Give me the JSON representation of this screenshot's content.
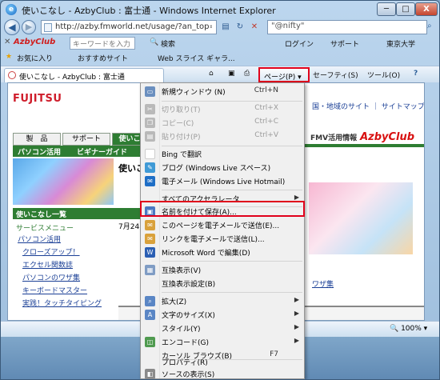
{
  "window": {
    "title": "使いこなし - AzbyClub : 富士通 - Windows Internet Explorer",
    "minimize": "─",
    "maximize": "□",
    "close": "X"
  },
  "address_bar": {
    "url": "http://azby.fmworld.net/usage/?an_top=",
    "search_text": "\"@nifty\""
  },
  "toolbar_azby": {
    "brand": "AzbyClub",
    "keyword_placeholder": "キーワードを入力",
    "search_label": "検索",
    "login_label": "ログイン",
    "support_label": "サポート",
    "univ_label": "東京大学"
  },
  "favorites_bar": {
    "favorites_label": "お気に入り",
    "suggested_label": "おすすめサイト",
    "webslice_label": "Web スライス ギャラ..."
  },
  "command_bar": {
    "tab_title": "使いこなし - AzbyClub : 富士通",
    "page_menu": "ページ(P)",
    "safety_menu": "セーフティ(S)",
    "tools_menu": "ツール(O)",
    "help_icon": "?"
  },
  "page": {
    "logo": "FUJITSU",
    "region_links": "国・地域のサイト ｜ サイトマップ",
    "tabs": [
      "製　品",
      "サポート",
      "使いこなし"
    ],
    "subnav": [
      "パソコン活用",
      "ビギナーガイド",
      "メ"
    ],
    "banner_sub": "FMV活用情報",
    "banner_brand": "AzbyClub",
    "main_heading": "使いこ",
    "main_date": "7月24",
    "main_link": "ワザ集",
    "sidebar_title": "使いこなし一覧",
    "sidebar_sub": "サービスメニュー",
    "sidebar_pc": "パソコン活用",
    "sidebar_links": [
      "クローズアップ！",
      "エクセル関数誌",
      "パソコンのワザ集",
      "キーボードマスター",
      "実践！タッチタイピング"
    ]
  },
  "status_bar": {
    "zoom": "100%"
  },
  "menu": {
    "items": [
      {
        "label": "新規ウィンドウ (N)",
        "shortcut": "Ctrl+N",
        "icon": "new-window-icon",
        "disabled": false,
        "submenu": false
      },
      {
        "label": "切り取り(T)",
        "shortcut": "Ctrl+X",
        "icon": "cut-icon",
        "disabled": true,
        "submenu": false
      },
      {
        "label": "コピー(C)",
        "shortcut": "Ctrl+C",
        "icon": "copy-icon",
        "disabled": true,
        "submenu": false
      },
      {
        "label": "貼り付け(P)",
        "shortcut": "Ctrl+V",
        "icon": "paste-icon",
        "disabled": true,
        "submenu": false
      },
      {
        "label": "Bing で翻訳",
        "shortcut": "",
        "icon": "bing-icon",
        "disabled": false,
        "submenu": false
      },
      {
        "label": "ブログ (Windows Live スペース)",
        "shortcut": "",
        "icon": "blog-icon",
        "disabled": false,
        "submenu": false
      },
      {
        "label": "電子メール (Windows Live Hotmail)",
        "shortcut": "",
        "icon": "hotmail-icon",
        "disabled": false,
        "submenu": false
      },
      {
        "label": "すべてのアクセラレータ",
        "shortcut": "",
        "icon": "",
        "disabled": false,
        "submenu": true
      },
      {
        "label": "名前を付けて保存(A)...",
        "shortcut": "",
        "icon": "save-icon",
        "disabled": false,
        "submenu": false
      },
      {
        "label": "このページを電子メールで送信(E)...",
        "shortcut": "",
        "icon": "mail-page-icon",
        "disabled": false,
        "submenu": false
      },
      {
        "label": "リンクを電子メールで送信(L)...",
        "shortcut": "",
        "icon": "mail-link-icon",
        "disabled": false,
        "submenu": false
      },
      {
        "label": "Microsoft Word で編集(D)",
        "shortcut": "",
        "icon": "word-icon",
        "disabled": false,
        "submenu": false
      },
      {
        "label": "互換表示(V)",
        "shortcut": "",
        "icon": "compat-icon",
        "disabled": false,
        "submenu": false
      },
      {
        "label": "互換表示設定(B)",
        "shortcut": "",
        "icon": "",
        "disabled": false,
        "submenu": false
      },
      {
        "label": "拡大(Z)",
        "shortcut": "",
        "icon": "zoom-icon",
        "disabled": false,
        "submenu": true
      },
      {
        "label": "文字のサイズ(X)",
        "shortcut": "",
        "icon": "text-size-icon",
        "disabled": false,
        "submenu": true
      },
      {
        "label": "スタイル(Y)",
        "shortcut": "",
        "icon": "",
        "disabled": false,
        "submenu": true
      },
      {
        "label": "エンコード(G)",
        "shortcut": "",
        "icon": "encoding-icon",
        "disabled": false,
        "submenu": true
      },
      {
        "label": "カーソル ブラウズ(B)",
        "shortcut": "F7",
        "icon": "",
        "disabled": false,
        "submenu": false
      },
      {
        "label": "プロパティ(R)",
        "shortcut": "",
        "icon": "",
        "disabled": false,
        "submenu": false
      },
      {
        "label": "ソースの表示(S)",
        "shortcut": "",
        "icon": "source-icon",
        "disabled": false,
        "submenu": false
      }
    ]
  }
}
